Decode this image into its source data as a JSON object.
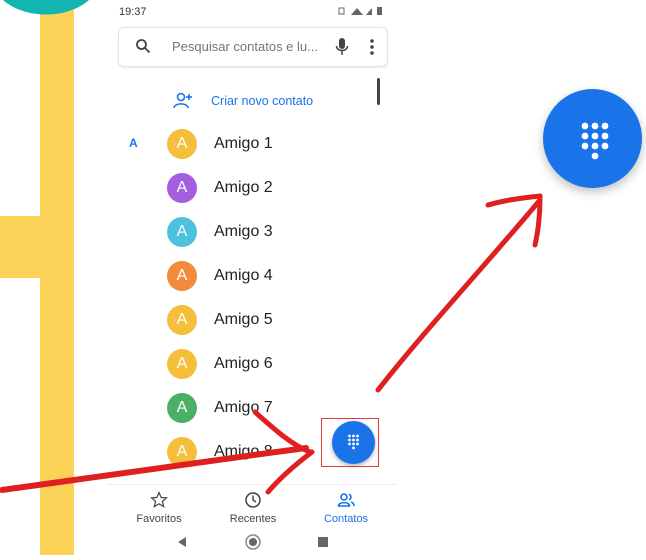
{
  "status_bar": {
    "time": "19:37",
    "icons": "vibrate wifi signal battery"
  },
  "search": {
    "placeholder": "Pesquisar contatos e lu..."
  },
  "create_contact": {
    "label": "Criar novo contato"
  },
  "section_letter": "A",
  "contacts": [
    {
      "initial": "A",
      "name": "Amigo 1",
      "color": "#f6bf3b"
    },
    {
      "initial": "A",
      "name": "Amigo 2",
      "color": "#a35fe0"
    },
    {
      "initial": "A",
      "name": "Amigo 3",
      "color": "#4cc2e0"
    },
    {
      "initial": "A",
      "name": "Amigo 4",
      "color": "#f28b3b"
    },
    {
      "initial": "A",
      "name": "Amigo 5",
      "color": "#f6bf3b"
    },
    {
      "initial": "A",
      "name": "Amigo 6",
      "color": "#f6bf3b"
    },
    {
      "initial": "A",
      "name": "Amigo 7",
      "color": "#4caf66"
    },
    {
      "initial": "A",
      "name": "Amigo 8",
      "color": "#f6bf3b"
    }
  ],
  "bottom_nav": {
    "favorites": "Favoritos",
    "recents": "Recentes",
    "contacts": "Contatos"
  },
  "colors": {
    "accent": "#1a73e8",
    "highlight_red": "#e53935",
    "rail_yellow": "#fbd257"
  }
}
